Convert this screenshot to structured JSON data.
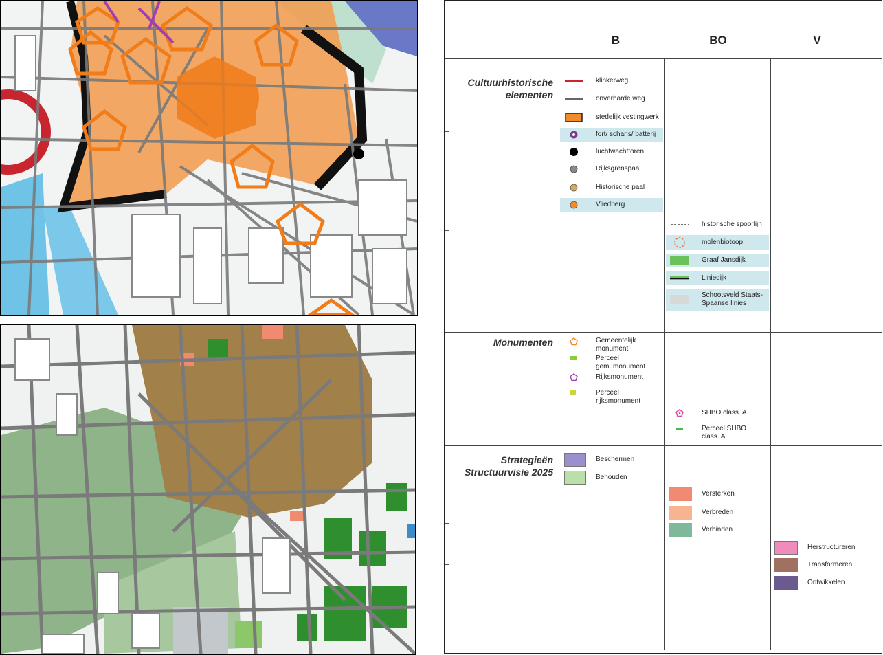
{
  "legend": {
    "columns": [
      "B",
      "BO",
      "V"
    ],
    "sections": {
      "cultuur": "Cultuurhistorische\nelementen",
      "monumenten": "Monumenten",
      "strategie": "Strategieën\nStructuurvisie 2025"
    },
    "items": {
      "klinkerweg": {
        "label": "klinkerweg",
        "color": "#c8252f"
      },
      "onverharde": {
        "label": "onverharde weg",
        "color": "#666666"
      },
      "vestingwerk": {
        "label": "stedelijk vestingwerk",
        "color": "#f28c2a"
      },
      "fort": {
        "label": "fort/ schans/ batterij",
        "color": "#7a3b8f"
      },
      "luchtwacht": {
        "label": "luchtwachttoren",
        "color": "#000000"
      },
      "rijksgrens": {
        "label": "Rijksgrenspaal",
        "color": "#8a8a8a"
      },
      "historischepaal": {
        "label": "Historische paal",
        "color": "#d9a860"
      },
      "vliedberg": {
        "label": "Vliedberg",
        "color": "#f28c2a"
      },
      "spoorlijn": {
        "label": "historische spoorlijn",
        "color": "#444444"
      },
      "molenbiotoop": {
        "label": "molenbiotoop",
        "color": "#f08040"
      },
      "graafjansdijk": {
        "label": "Graaf Jansdijk",
        "color": "#6bc25a"
      },
      "liniedijk": {
        "label": "Liniedijk",
        "color": "#2a7a2a"
      },
      "schootsveld": {
        "label": "Schootsveld Staats-\nSpaanse linies",
        "color": "#d6d9d6"
      },
      "gemeentelijk": {
        "label": "Gemeentelijk\nmonument",
        "color": "#f28c2a"
      },
      "perceelgem": {
        "label": "Perceel\ngem. monument",
        "color": "#8ccc3c"
      },
      "rijksmonument": {
        "label": "Rijksmonument",
        "color": "#a040b0"
      },
      "perceelrijks": {
        "label": "Perceel\nrijksmonument",
        "color": "#c8d83c"
      },
      "shbo": {
        "label": "SHBO class. A",
        "color": "#e04aa0"
      },
      "perceelshbo": {
        "label": "Perceel SHBO\nclass. A",
        "color": "#4cb84c"
      },
      "beschermen": {
        "label": "Beschermen",
        "color": "#9c8fcf"
      },
      "behouden": {
        "label": "Behouden",
        "color": "#b8e0a8"
      },
      "versterken": {
        "label": "Versterken",
        "color": "#f08a70"
      },
      "verbreden": {
        "label": "Verbreden",
        "color": "#f7b490"
      },
      "verbinden": {
        "label": "Verbinden",
        "color": "#7fb89a"
      },
      "herstructureren": {
        "label": "Herstructureren",
        "color": "#f08cbc"
      },
      "transformeren": {
        "label": "Transformeren",
        "color": "#a07060"
      },
      "ontwikkelen": {
        "label": "Ontwikkelen",
        "color": "#6a5a90"
      }
    }
  }
}
